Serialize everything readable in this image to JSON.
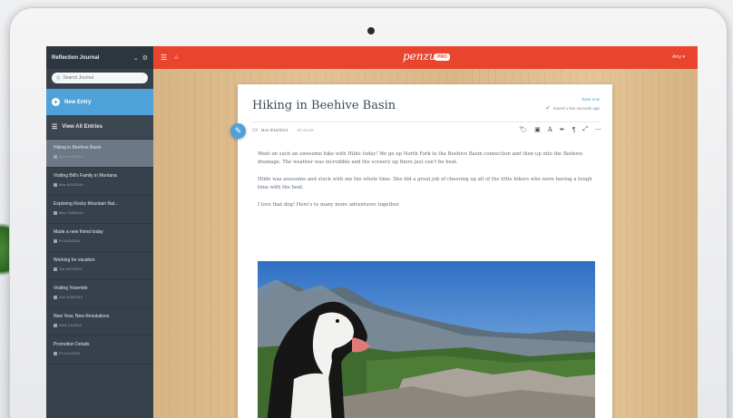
{
  "sidebar": {
    "journal_title": "Reflection Journal",
    "search_placeholder": "Search Journal",
    "new_entry_label": "New Entry",
    "view_all_label": "View All Entries",
    "entries": [
      {
        "title": "Hiking in Beehive Basin",
        "date": "Mon 9/15/2014",
        "active": true
      },
      {
        "title": "Visiting Bill's Family in Montana",
        "date": "Mon 8/25/2014",
        "active": false
      },
      {
        "title": "Exploring Rocky Mountain Nat...",
        "date": "Mon 7/28/2014",
        "active": false
      },
      {
        "title": "Made a new friend today",
        "date": "Fri 6/20/2014",
        "active": false
      },
      {
        "title": "Working for vacation",
        "date": "Tue 5/27/2014",
        "active": false
      },
      {
        "title": "Visiting Yosemite",
        "date": "Sun 4/20/2014",
        "active": false
      },
      {
        "title": "New Year, New Resolutions",
        "date": "Wed 1/1/2014",
        "active": false
      },
      {
        "title": "Promotion Details",
        "date": "Fri 11/1/2013",
        "active": false
      }
    ]
  },
  "topbar": {
    "brand": "penzu",
    "brand_badge": "PRO",
    "user_menu": "Amy ▾"
  },
  "editor": {
    "title": "Hiking in Beehive Basin",
    "save_now": "Save now",
    "saved_status": "Saved a few seconds ago",
    "date": "Mon 9/15/2014",
    "word_count": "83 words",
    "paragraphs": [
      "Went on such an awesome hike with Hilde today! We go up North Fork to the Beehive Basin connection and then up into the Beehive drainage. The weather was incredible and the scenery up there just can't be beat.",
      "Hilde was awesome and stuck with me the whole time. She did a great job of cheering up all of the little hikers who were having a tough time with the heat.",
      "I love that dog! Here's to many more adventures together."
    ]
  },
  "colors": {
    "topbar": "#e9452e",
    "accent": "#4fa1da",
    "sidebar": "#37414c"
  }
}
